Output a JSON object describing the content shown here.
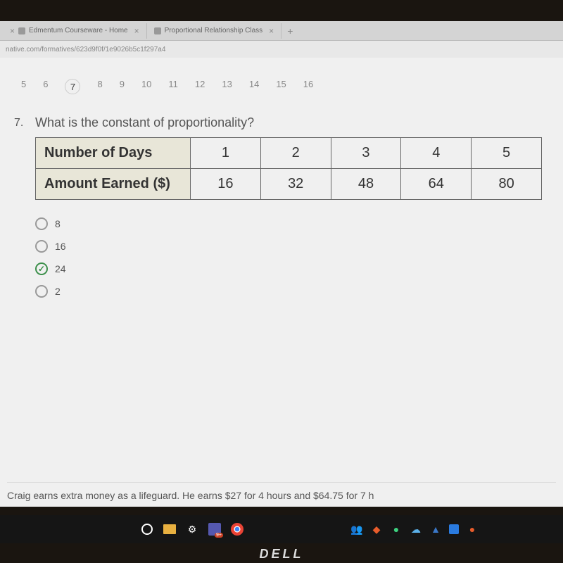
{
  "browser": {
    "tabs": [
      {
        "title": "Edmentum Courseware - Home"
      },
      {
        "title": "Proportional Relationship Class"
      }
    ],
    "url": "native.com/formatives/623d9f0f/1e9026b5c1f297a4"
  },
  "nav": {
    "items": [
      "5",
      "6",
      "7",
      "8",
      "9",
      "10",
      "11",
      "12",
      "13",
      "14",
      "15",
      "16"
    ],
    "current": "7"
  },
  "question": {
    "number": "7.",
    "text": "What is the constant of proportionality?",
    "table": {
      "rows": [
        {
          "label": "Number of Days",
          "cells": [
            "1",
            "2",
            "3",
            "4",
            "5"
          ]
        },
        {
          "label": "Amount Earned ($)",
          "cells": [
            "16",
            "32",
            "48",
            "64",
            "80"
          ]
        }
      ]
    },
    "options": [
      "8",
      "16",
      "24",
      "2"
    ],
    "selected": "24"
  },
  "next_question_preview": "Craig earns extra money as a lifeguard. He earns $27 for 4 hours and $64.75 for 7 h",
  "taskbar": {
    "teams_badge": "9+"
  },
  "brand": "DELL"
}
